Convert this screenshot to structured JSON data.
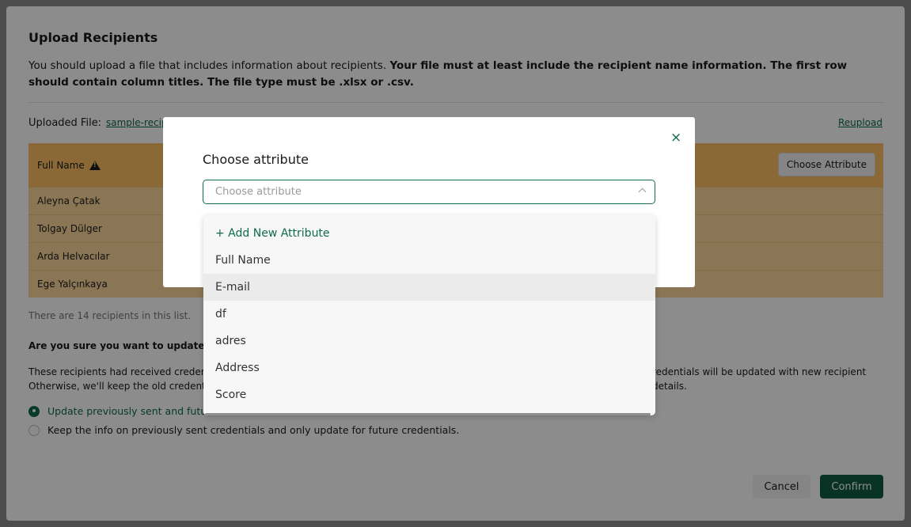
{
  "page": {
    "title": "Upload Recipients",
    "description_plain": "You should upload a file that includes information about recipients. ",
    "description_bold": "Your file must at least include the recipient name information. The first row should contain column titles. The file type must be .xlsx or .csv.",
    "uploaded_label": "Uploaded File:",
    "uploaded_file": "sample-recip",
    "reupload": "Reupload",
    "table": {
      "header_name": "Full Name",
      "choose_attribute_btn": "Choose Attribute",
      "rows": [
        "Aleyna Çatak",
        "Tolgay Dülger",
        "Arda Helvacılar",
        "Ege Yalçınkaya"
      ]
    },
    "count_text": "There are 14 recipients in this list.",
    "question": "Are you sure you want to update these r",
    "explain_left_1": "These recipients had received credentials",
    "explain_left_2": "Otherwise, we'll keep the old credentials",
    "explain_right": "redentials will be updated with new recipient details.",
    "radio_1": "Update previously sent and future c",
    "radio_2": "Keep the info on previously sent credentials and only update for future credentials.",
    "cancel": "Cancel",
    "confirm": "Confirm"
  },
  "modal": {
    "title": "Choose attribute",
    "close_icon": "×",
    "select_placeholder": "Choose attribute",
    "options": [
      "+ Add New Attribute",
      "Full Name",
      "E-mail",
      "df",
      "adres",
      "Address",
      "Score"
    ]
  },
  "colors": {
    "accent": "#0e6b4e",
    "table_header": "#fbbf63",
    "confirm_bg": "#0d5c43"
  }
}
